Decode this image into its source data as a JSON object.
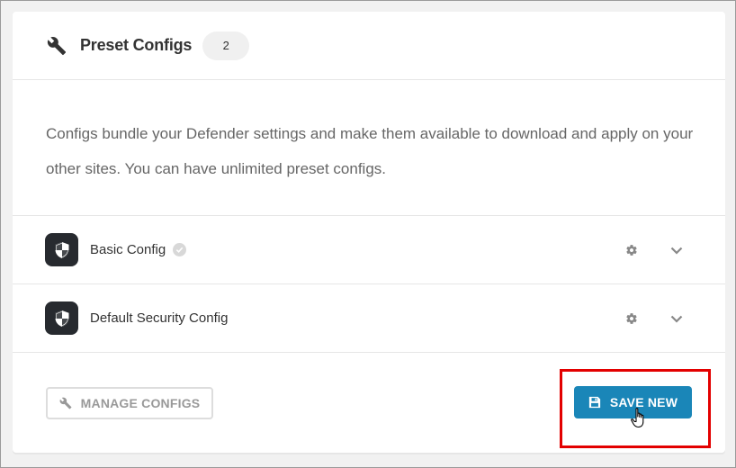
{
  "header": {
    "title": "Preset Configs",
    "count": "2",
    "icon": "wrench-icon"
  },
  "body": {
    "description": "Configs bundle your Defender settings and make them available to download and apply on your other sites. You can have unlimited preset configs."
  },
  "configs": [
    {
      "name": "Basic Config",
      "is_default": true,
      "icon": "shield-icon"
    },
    {
      "name": "Default Security Config",
      "is_default": false,
      "icon": "shield-icon"
    }
  ],
  "footer": {
    "manage_label": "MANAGE CONFIGS",
    "save_label": "SAVE NEW"
  },
  "colors": {
    "primary_button": "#1a86b8",
    "highlight": "#e30000",
    "shield_bg": "#272a2f"
  }
}
